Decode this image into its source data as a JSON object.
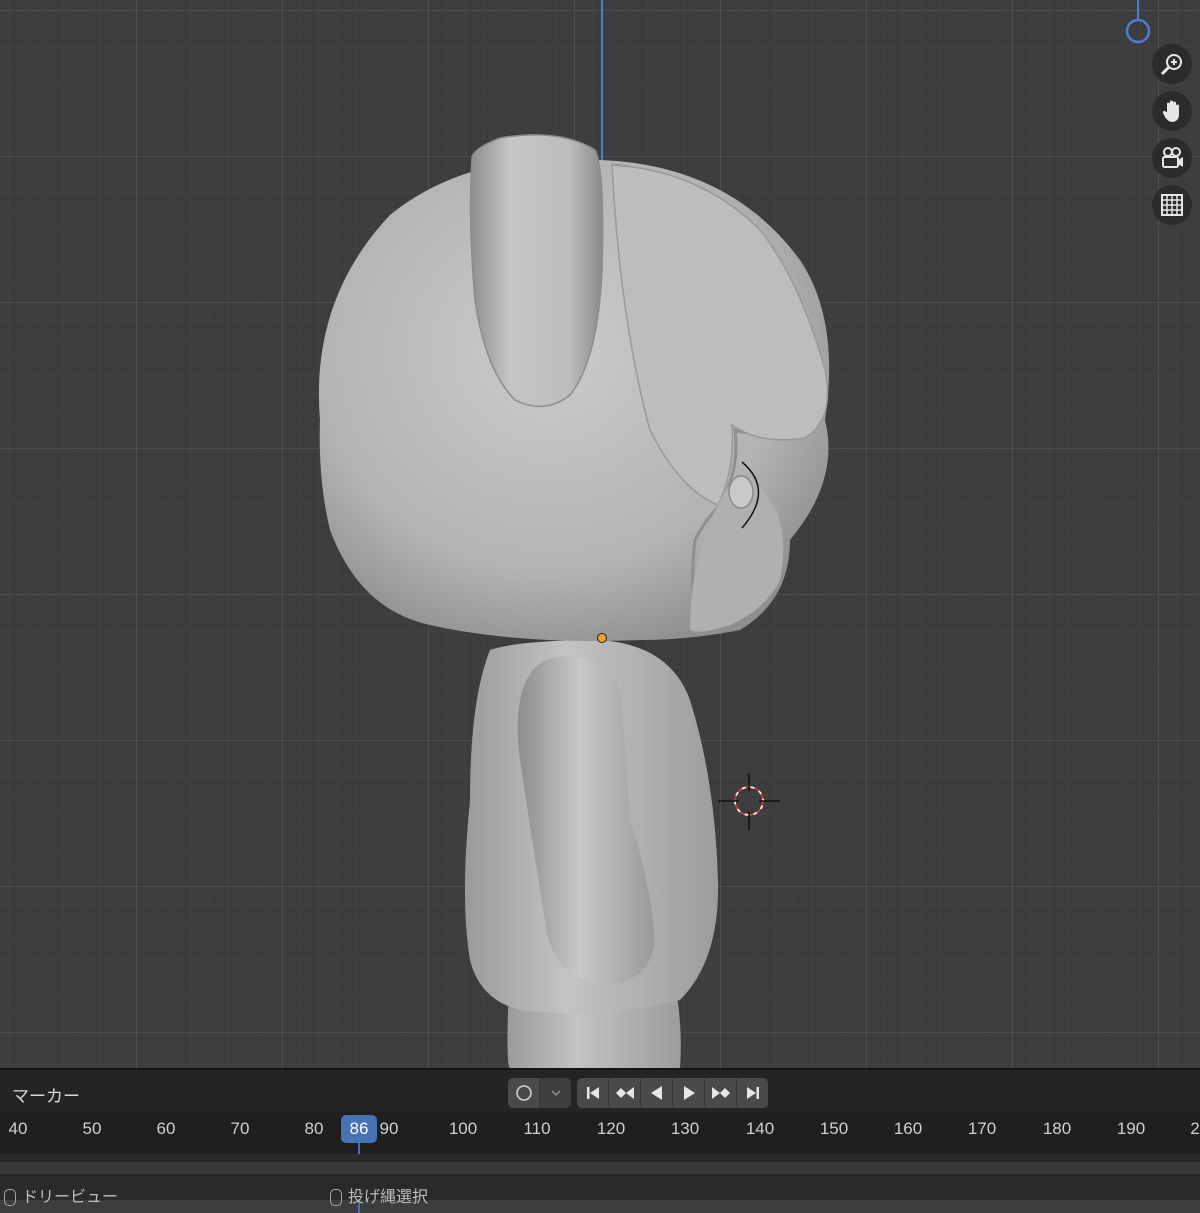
{
  "viewport": {
    "nav_gizmos": [
      "zoom-icon",
      "hand-pan-icon",
      "camera-icon",
      "grid-icon"
    ],
    "colors": {
      "background": "#3d3d3d",
      "axis_line": "#4a7fd1",
      "model": "#b8b8b8",
      "origin_dot": "#f0a030"
    }
  },
  "timeline": {
    "marker_label": "マーカー",
    "ruler_labels": [
      "40",
      "50",
      "60",
      "70",
      "80",
      "90",
      "100",
      "110",
      "120",
      "130",
      "140",
      "150",
      "160",
      "170",
      "180",
      "190",
      "2"
    ],
    "current_frame": "86"
  },
  "status_bar": {
    "left_action": "ドリービュー",
    "middle_action": "投げ縄選択"
  }
}
